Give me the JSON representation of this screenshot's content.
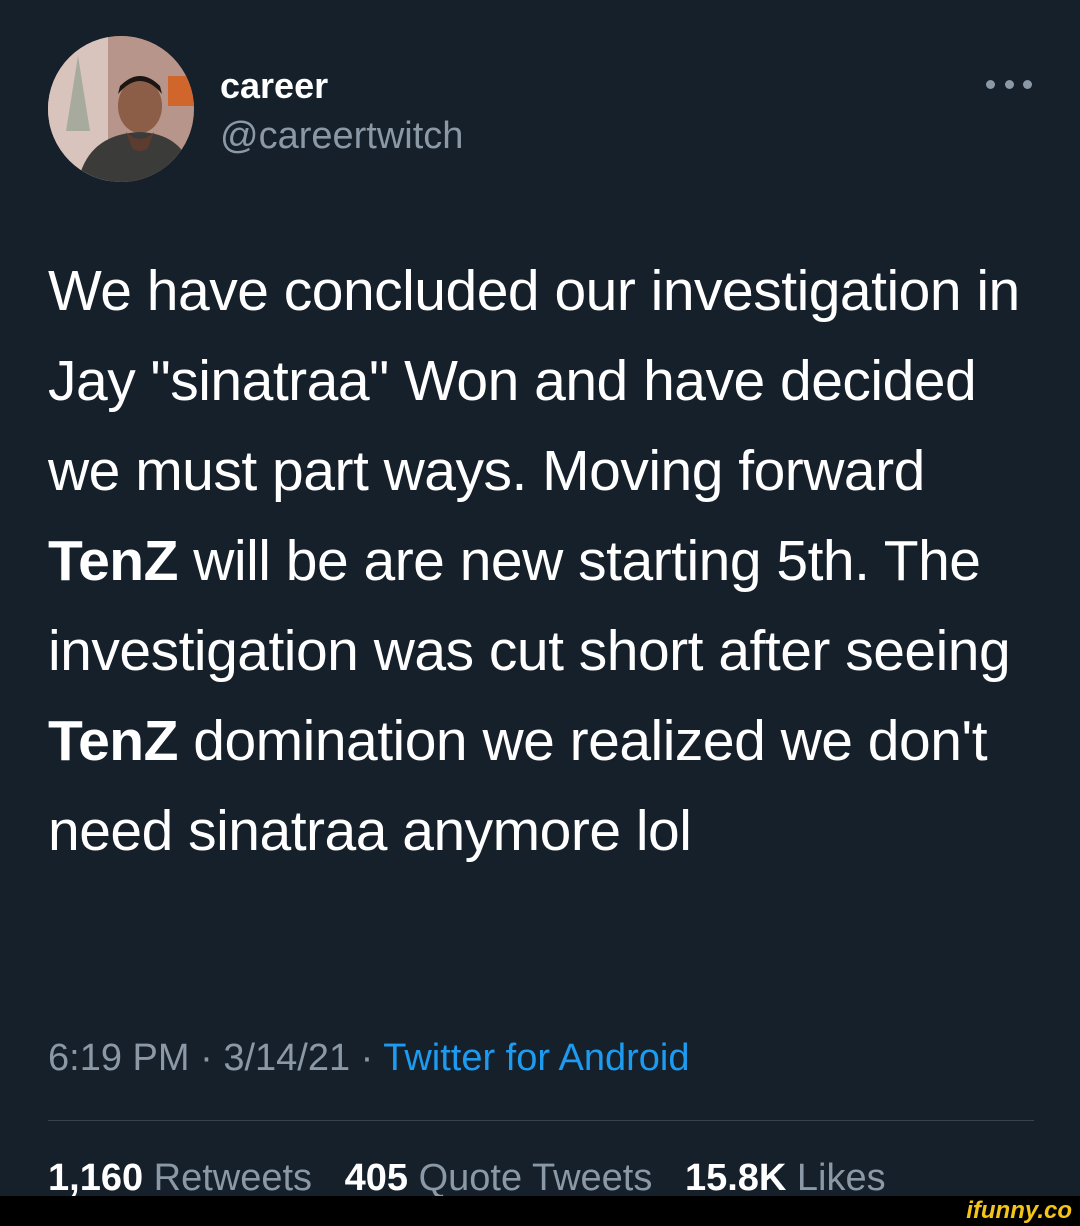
{
  "tweet": {
    "author": {
      "display_name": "career",
      "handle": "@careertwitch",
      "avatar_icon": "profile-photo"
    },
    "more_icon": "more-horizontal-icon",
    "text_segments": [
      {
        "text": "We have concluded our investigation in Jay \"sinatraa\" Won and have decided we must part ways. Moving forward ",
        "bold": false
      },
      {
        "text": "TenZ",
        "bold": true
      },
      {
        "text": " will be are new starting 5th. The investigation was cut short after seeing ",
        "bold": false
      },
      {
        "text": "TenZ",
        "bold": true
      },
      {
        "text": " domination we realized we don't need sinatraa anymore lol",
        "bold": false
      }
    ],
    "meta": {
      "time": "6:19 PM",
      "separator": "·",
      "date": "3/14/21",
      "source": "Twitter for Android"
    },
    "stats": [
      {
        "count": "1,160",
        "label": "Retweets"
      },
      {
        "count": "405",
        "label": "Quote Tweets"
      },
      {
        "count": "15.8K",
        "label": "Likes"
      }
    ]
  },
  "watermark": "ifunny.co",
  "colors": {
    "background": "#15202b",
    "text": "#ffffff",
    "secondary": "#8b98a5",
    "link": "#1d9bf0",
    "divider": "#38444d",
    "watermark": "#f4c518"
  }
}
